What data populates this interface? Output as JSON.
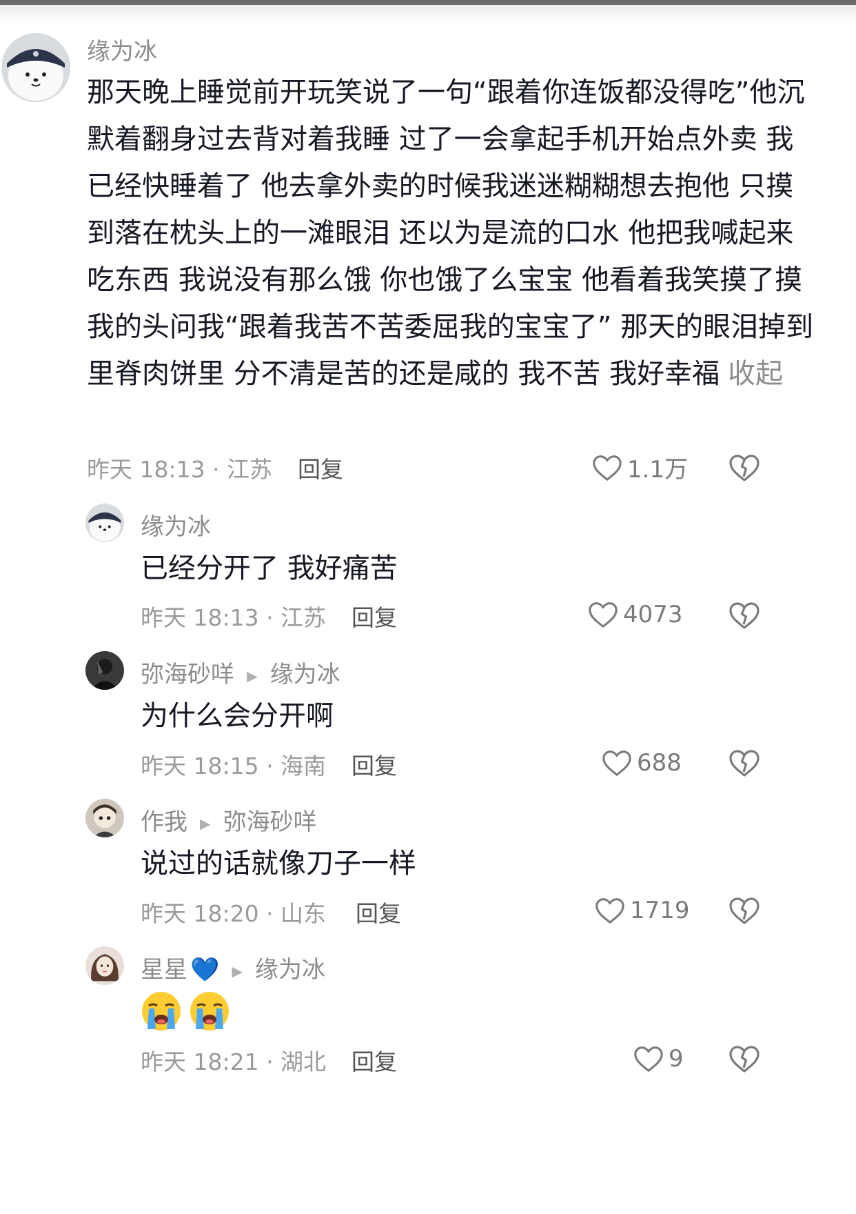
{
  "comments": [
    {
      "username": "缘为冰",
      "content": "那天晚上睡觉前开玩笑说了一句“跟着你连饭都没得吃”他沉默着翻身过去背对着我睡 过了一会拿起手机开始点外卖 我已经快睡着了 他去拿外卖的时候我迷迷糊糊想去抱他 只摸到落在枕头上的一滩眼泪 还以为是流的口水 他把我喊起来吃东西 我说没有那么饿 你也饿了么宝宝 他看着我笑摸了摸我的头问我“跟着我苦不苦委屈我的宝宝了” 那天的眼泪掉到里脊肉饼里 分不清是苦的还是咸的 我不苦 我好幸福",
      "collapse_label": "收起",
      "meta": "昨天 18:13 · 江苏",
      "reply_label": "回复",
      "likes": "1.1万",
      "avatar": "white-bear-avatar"
    },
    {
      "username": "缘为冰",
      "content": "已经分开了 我好痛苦",
      "meta": "昨天 18:13 · 江苏",
      "reply_label": "回复",
      "likes": "4073",
      "avatar": "white-bear-avatar"
    },
    {
      "username": "弥海砂咩",
      "reply_to": "缘为冰",
      "content": "为什么会分开啊",
      "meta": "昨天 18:15 · 海南",
      "reply_label": "回复",
      "likes": "688",
      "avatar": "dark-photo-avatar"
    },
    {
      "username": "作我",
      "reply_to": "弥海砂咩",
      "content": "说过的话就像刀子一样",
      "meta": "昨天 18:20 · 山东",
      "reply_label": "回复",
      "likes": "1719",
      "avatar": "cartoon-avatar"
    },
    {
      "username": "星星",
      "username_suffix": "💙",
      "reply_to": "缘为冰",
      "content_emojis": [
        "loudly-crying-face",
        "loudly-crying-face"
      ],
      "meta": "昨天 18:21 · 湖北",
      "reply_label": "回复",
      "likes": "9",
      "avatar": "girl-photo-avatar"
    }
  ],
  "colors": {
    "primary_text": "#161823",
    "secondary_text": "#8c8c8c",
    "meta_text": "#9a9a9a",
    "heart_blue": "#2f7ff5"
  }
}
